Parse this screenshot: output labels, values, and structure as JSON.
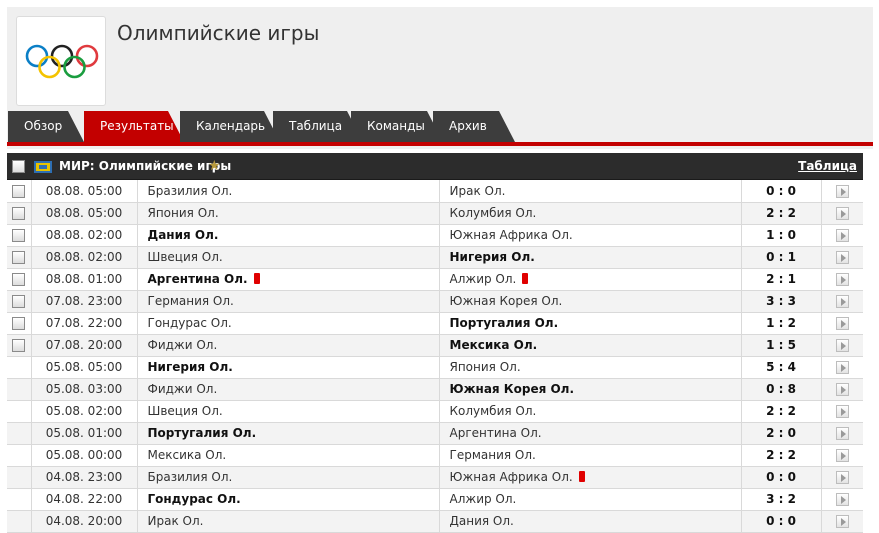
{
  "header": {
    "title": "Олимпийские игры"
  },
  "tabs": [
    {
      "label": "Обзор",
      "active": false
    },
    {
      "label": "Результаты",
      "active": true
    },
    {
      "label": "Календарь",
      "active": false
    },
    {
      "label": "Таблица",
      "active": false
    },
    {
      "label": "Команды",
      "active": false
    },
    {
      "label": "Архив",
      "active": false
    }
  ],
  "league": {
    "name": "МИР: Олимпийские игры",
    "table_link": "Таблица",
    "star_icon": "star-icon",
    "flag_icon": "world-flag-icon"
  },
  "colors": {
    "accent_red": "#c30000",
    "tab_dark": "#3d3d3d",
    "league_bar": "#2c2c2c",
    "red_card": "#e00000"
  },
  "matches": [
    {
      "time": "08.08. 05:00",
      "home": "Бразилия Ол.",
      "away": "Ирак Ол.",
      "score": "0 : 0",
      "checkbox": true
    },
    {
      "time": "08.08. 05:00",
      "home": "Япония Ол.",
      "away": "Колумбия Ол.",
      "score": "2 : 2",
      "checkbox": true
    },
    {
      "time": "08.08. 02:00",
      "home": "Дания Ол.",
      "away": "Южная Африка Ол.",
      "score": "1 : 0",
      "checkbox": true,
      "home_bold": true
    },
    {
      "time": "08.08. 02:00",
      "home": "Швеция Ол.",
      "away": "Нигерия Ол.",
      "score": "0 : 1",
      "checkbox": true,
      "away_bold": true
    },
    {
      "time": "08.08. 01:00",
      "home": "Аргентина Ол.",
      "away": "Алжир Ол.",
      "score": "2 : 1",
      "checkbox": true,
      "home_bold": true,
      "home_red": true,
      "away_red": true
    },
    {
      "time": "07.08. 23:00",
      "home": "Германия Ол.",
      "away": "Южная Корея Ол.",
      "score": "3 : 3",
      "checkbox": true
    },
    {
      "time": "07.08. 22:00",
      "home": "Гондурас Ол.",
      "away": "Португалия Ол.",
      "score": "1 : 2",
      "checkbox": true,
      "away_bold": true
    },
    {
      "time": "07.08. 20:00",
      "home": "Фиджи Ол.",
      "away": "Мексика Ол.",
      "score": "1 : 5",
      "checkbox": true,
      "away_bold": true
    },
    {
      "time": "05.08. 05:00",
      "home": "Нигерия Ол.",
      "away": "Япония Ол.",
      "score": "5 : 4",
      "home_bold": true
    },
    {
      "time": "05.08. 03:00",
      "home": "Фиджи Ол.",
      "away": "Южная Корея Ол.",
      "score": "0 : 8",
      "away_bold": true
    },
    {
      "time": "05.08. 02:00",
      "home": "Швеция Ол.",
      "away": "Колумбия Ол.",
      "score": "2 : 2"
    },
    {
      "time": "05.08. 01:00",
      "home": "Португалия Ол.",
      "away": "Аргентина Ол.",
      "score": "2 : 0",
      "home_bold": true
    },
    {
      "time": "05.08. 00:00",
      "home": "Мексика Ол.",
      "away": "Германия Ол.",
      "score": "2 : 2"
    },
    {
      "time": "04.08. 23:00",
      "home": "Бразилия Ол.",
      "away": "Южная Африка Ол.",
      "score": "0 : 0",
      "away_red": true
    },
    {
      "time": "04.08. 22:00",
      "home": "Гондурас Ол.",
      "away": "Алжир Ол.",
      "score": "3 : 2",
      "home_bold": true
    },
    {
      "time": "04.08. 20:00",
      "home": "Ирак Ол.",
      "away": "Дания Ол.",
      "score": "0 : 0"
    }
  ]
}
